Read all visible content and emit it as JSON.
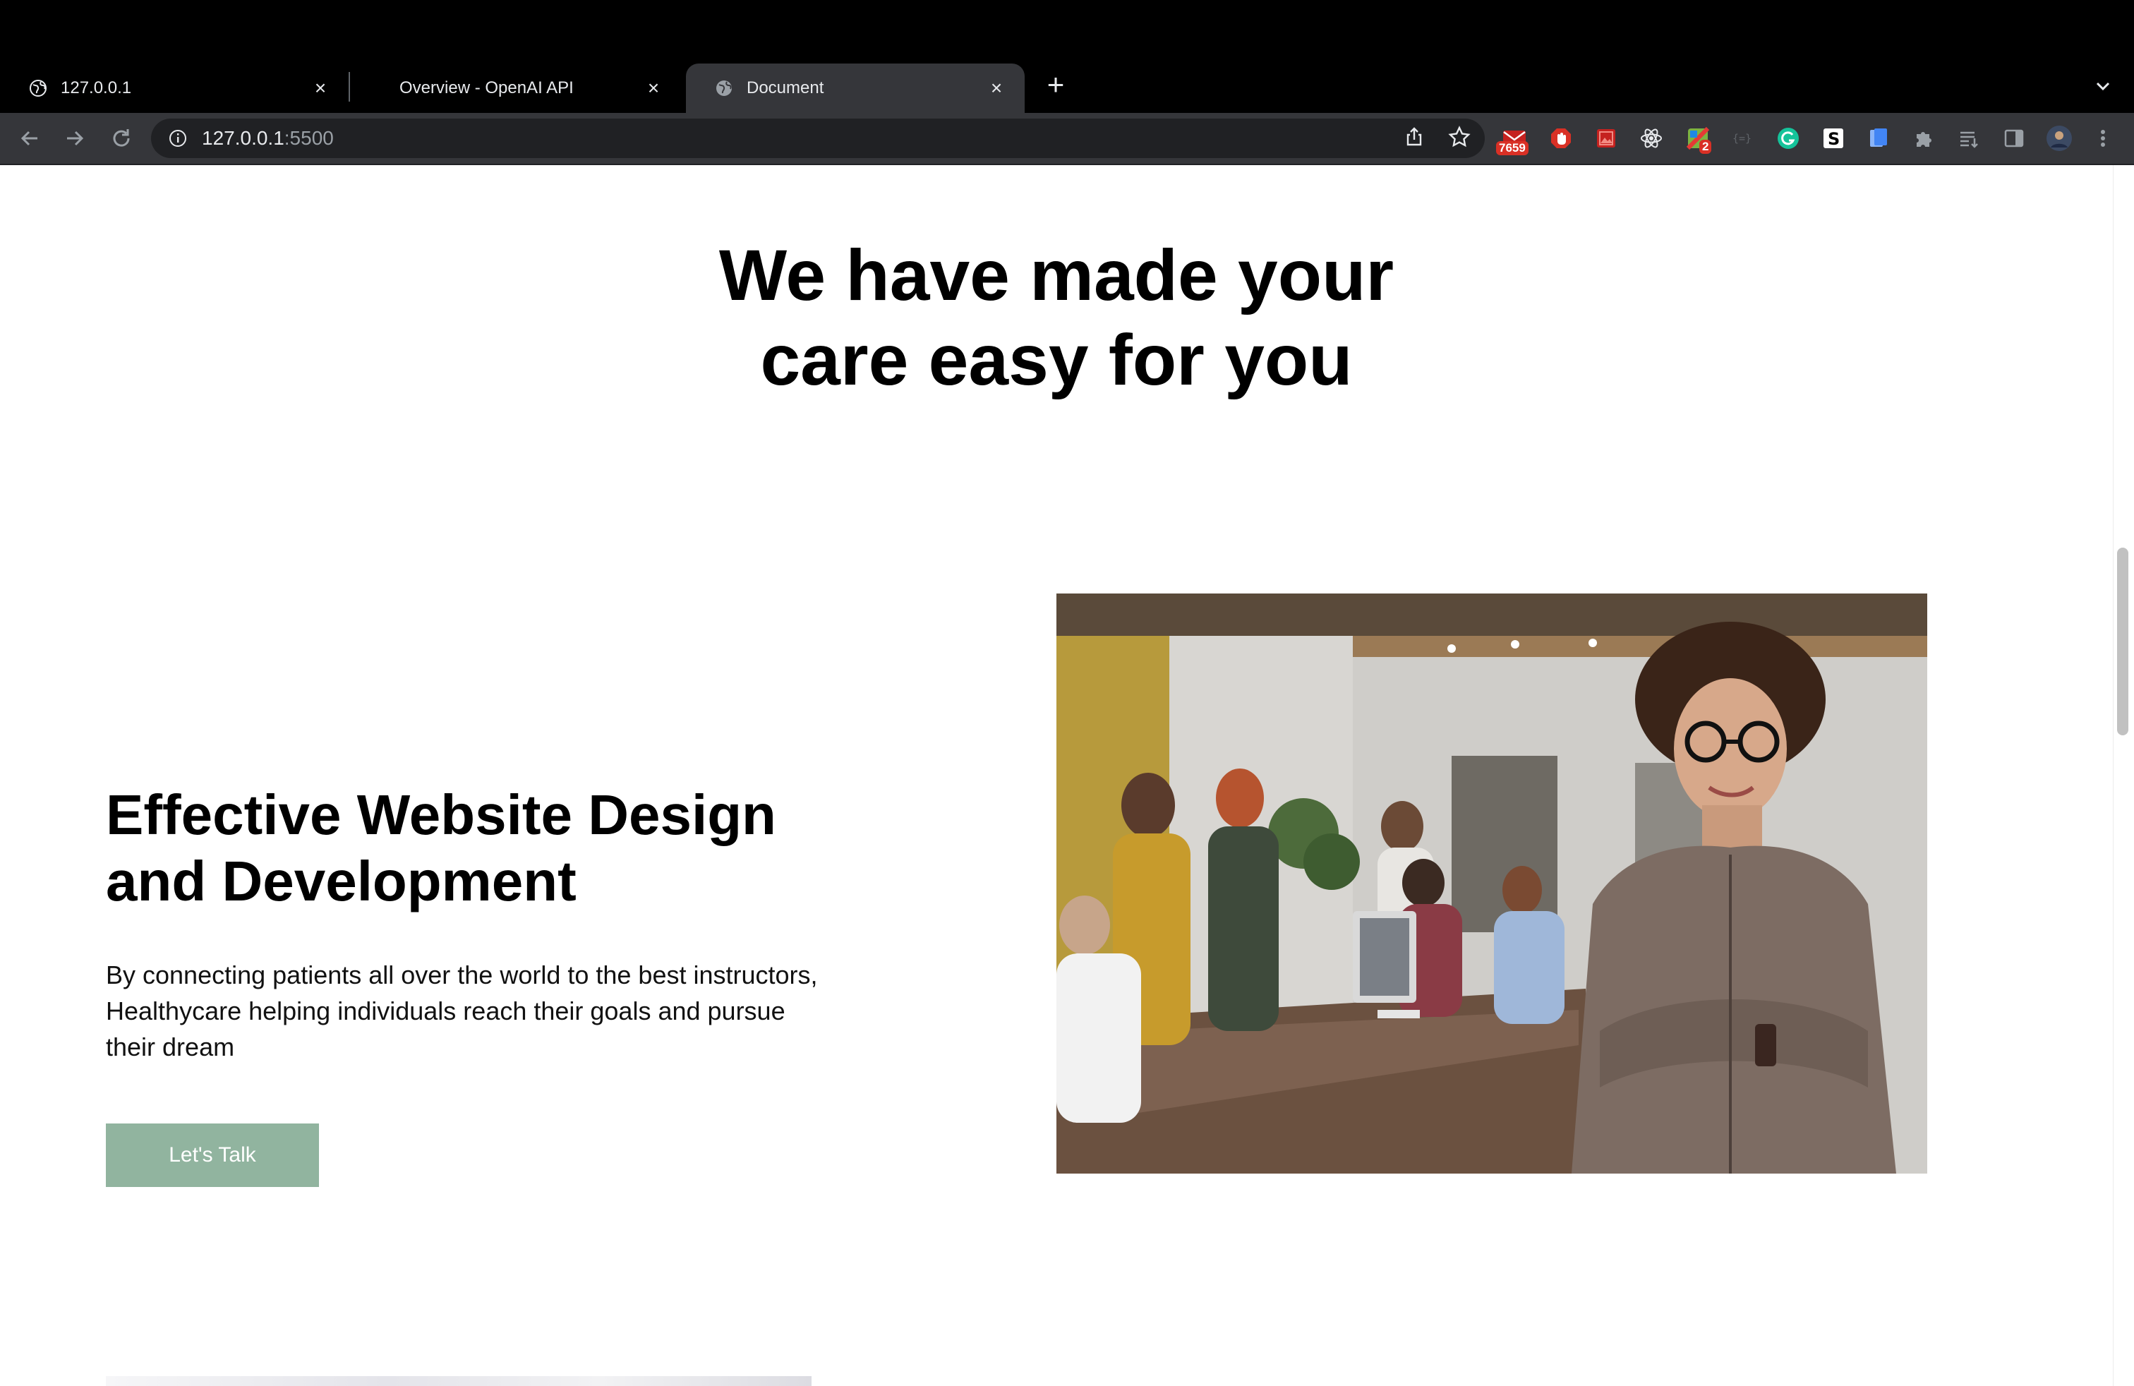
{
  "browser": {
    "tabs": [
      {
        "title": "127.0.0.1",
        "favicon": "globe-icon",
        "active": false
      },
      {
        "title": "Overview - OpenAI API",
        "favicon": "openai-icon",
        "active": false
      },
      {
        "title": "Document",
        "favicon": "globe-icon",
        "active": true
      }
    ],
    "url_host": "127.0.0.1",
    "url_port": ":5500",
    "extensions": [
      {
        "name": "mail-extension-icon",
        "badge": "7659"
      },
      {
        "name": "adblock-icon"
      },
      {
        "name": "image-extension-icon"
      },
      {
        "name": "react-devtools-icon"
      },
      {
        "name": "extension-icon",
        "badge": "2"
      },
      {
        "name": "json-viewer-icon"
      },
      {
        "name": "grammarly-icon"
      },
      {
        "name": "s-extension-icon"
      },
      {
        "name": "docs-extension-icon"
      }
    ]
  },
  "hero": {
    "heading_line1": "We have made your",
    "heading_line2": "care easy for you"
  },
  "feature": {
    "title_line1": "Effective Website Design",
    "title_line2": "and Development",
    "description": "By connecting patients all over the world to the best instructors, Healthycare helping individuals reach their goals and pursue their dream",
    "cta_label": "Let's Talk"
  },
  "colors": {
    "cta_background": "#91b49f",
    "chrome_background": "#000000",
    "toolbar_background": "#35363a"
  }
}
